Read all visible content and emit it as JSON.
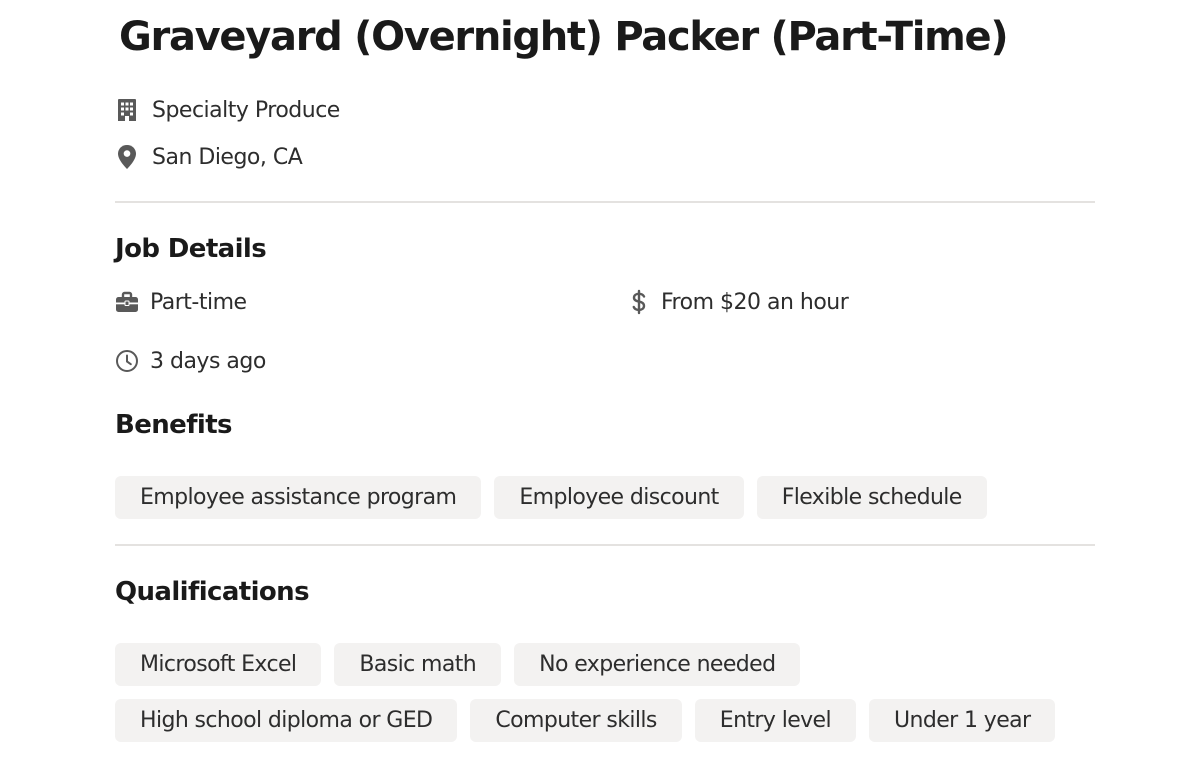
{
  "job": {
    "title": "Graveyard (Overnight) Packer (Part-Time)",
    "company": {
      "name": "Specialty Produce",
      "icon": "building-icon"
    },
    "location": {
      "text": "San Diego, CA",
      "icon": "location-pin-icon"
    }
  },
  "job_details": {
    "heading": "Job Details",
    "job_type": {
      "text": "Part-time",
      "icon": "briefcase-icon"
    },
    "pay": {
      "text": "From $20 an hour",
      "icon": "dollar-icon"
    },
    "posted": {
      "text": "3 days ago",
      "icon": "clock-icon"
    }
  },
  "benefits": {
    "heading": "Benefits",
    "items": [
      "Employee assistance program",
      "Employee discount",
      "Flexible schedule"
    ]
  },
  "qualifications": {
    "heading": "Qualifications",
    "row1": [
      "Microsoft Excel",
      "Basic math",
      "No experience needed"
    ],
    "row2": [
      "High school diploma or GED",
      "Computer skills",
      "Entry level",
      "Under 1 year"
    ]
  },
  "colors": {
    "text": "#2d2d2d",
    "heading": "#1a1a1a",
    "tag_background": "#f3f2f1",
    "divider": "#e4e2e0",
    "icon": "#595959"
  }
}
